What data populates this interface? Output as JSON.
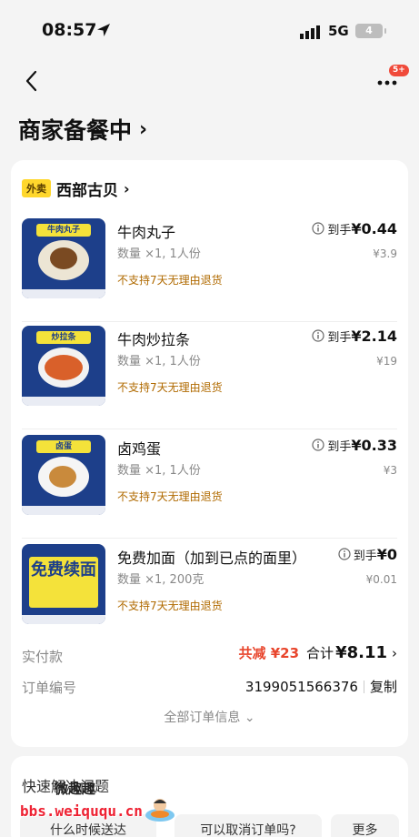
{
  "status_bar": {
    "time": "08:57",
    "network": "5G",
    "battery": "4"
  },
  "nav": {
    "badge": "5+"
  },
  "header": {
    "title": "商家备餐中",
    "chevron": "›"
  },
  "merchant": {
    "tag": "外卖",
    "name": "西部古贝",
    "chevron": "›"
  },
  "items": [
    {
      "name": "牛肉丸子",
      "qty": "数量 ×1, 1人份",
      "policy": "不支持7天无理由退货",
      "final_label": "到手",
      "final_price": "¥0.44",
      "orig_price": "¥3.9",
      "thumb_banner": "牛肉丸子"
    },
    {
      "name": "牛肉炒拉条",
      "qty": "数量 ×1, 1人份",
      "policy": "不支持7天无理由退货",
      "final_label": "到手",
      "final_price": "¥2.14",
      "orig_price": "¥19",
      "thumb_banner": "炒拉条"
    },
    {
      "name": "卤鸡蛋",
      "qty": "数量 ×1, 1人份",
      "policy": "不支持7天无理由退货",
      "final_label": "到手",
      "final_price": "¥0.33",
      "orig_price": "¥3",
      "thumb_banner": "卤蛋"
    },
    {
      "name": "免费加面（加到已点的面里）",
      "qty": "数量 ×1, 200克",
      "policy": "不支持7天无理由退货",
      "final_label": "到手",
      "final_price": "¥0",
      "orig_price": "¥0.01",
      "thumb_banner": "免费续面"
    }
  ],
  "payment": {
    "label": "实付款",
    "discount": "共减 ¥23",
    "total_label": "合计",
    "total_value": "¥8.11",
    "chevron": "›"
  },
  "order": {
    "label": "订单编号",
    "number": "3199051566376",
    "copy": "复制"
  },
  "all_info": "全部订单信息 ⌄",
  "help": {
    "title": "快速解决问题",
    "chips": [
      "什么时候送达",
      "可以取消订单吗?",
      "更多"
    ]
  },
  "watermark": {
    "cn": "微趣趣",
    "url": "bbs.weiququ.cn"
  },
  "colors": {
    "accent_red": "#e8452c",
    "tag_yellow": "#ffd72c",
    "policy_orange": "#b06a00",
    "thumb_blue": "#1d3f8a"
  }
}
